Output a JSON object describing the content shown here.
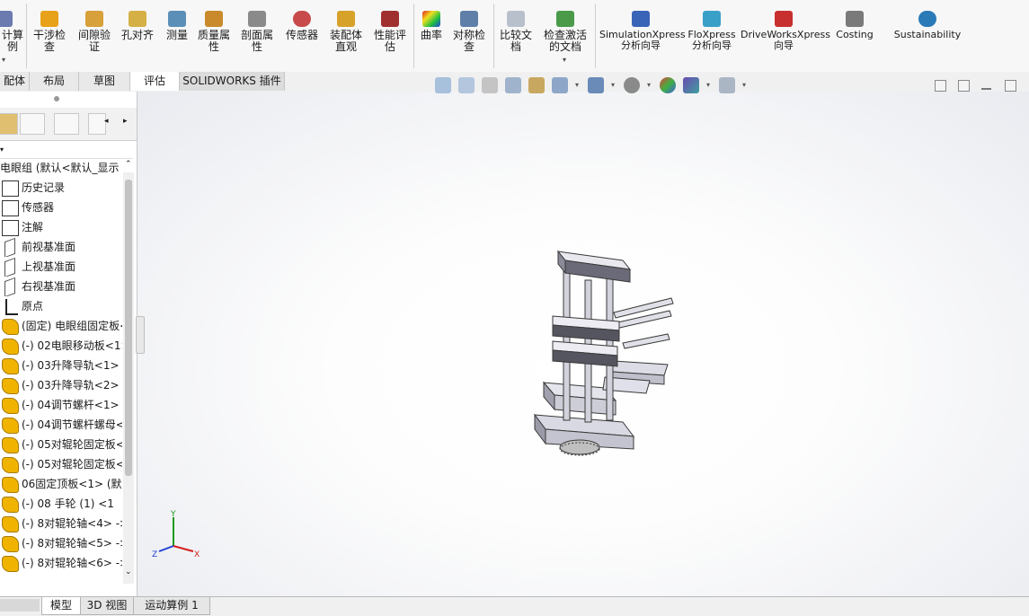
{
  "ribbon": {
    "partial_left_label": "计算例",
    "buttons": [
      {
        "label": "干涉检查",
        "icon": "interference-check-icon"
      },
      {
        "label": "间隙验证",
        "icon": "clearance-verification-icon"
      },
      {
        "label": "孔对齐",
        "icon": "hole-alignment-icon"
      },
      {
        "label": "测量",
        "icon": "measure-icon"
      },
      {
        "label": "质量属性",
        "icon": "mass-properties-icon"
      },
      {
        "label": "剖面属性",
        "icon": "section-properties-icon"
      },
      {
        "label": "传感器",
        "icon": "sensor-icon"
      },
      {
        "label": "装配体直观",
        "icon": "assembly-visualization-icon"
      },
      {
        "label": "性能评估",
        "icon": "performance-evaluation-icon"
      },
      {
        "label": "曲率",
        "icon": "curvature-icon"
      },
      {
        "label": "对称检查",
        "icon": "symmetry-check-icon"
      },
      {
        "label": "比较文档",
        "icon": "compare-documents-icon"
      },
      {
        "label": "检查激活的文档",
        "icon": "check-active-document-icon"
      },
      {
        "label": "SimulationXpress 分析向导",
        "icon": "simulationxpress-icon"
      },
      {
        "label": "FloXpress 分析向导",
        "icon": "floxpress-icon"
      },
      {
        "label": "DriveWorksXpress 向导",
        "icon": "driveworksxpress-icon"
      },
      {
        "label": "Costing",
        "icon": "costing-icon"
      },
      {
        "label": "Sustainability",
        "icon": "sustainability-icon"
      }
    ]
  },
  "tabs": [
    {
      "label": "配体"
    },
    {
      "label": "布局"
    },
    {
      "label": "草图"
    },
    {
      "label": "评估"
    },
    {
      "label": "SOLIDWORKS 插件"
    }
  ],
  "tree": {
    "root": "电眼组 (默认<默认_显示",
    "items": [
      {
        "label": "历史记录",
        "icon": "history-folder-icon"
      },
      {
        "label": "传感器",
        "icon": "sensor-folder-icon"
      },
      {
        "label": "注解",
        "icon": "annotation-folder-icon"
      },
      {
        "label": "前视基准面",
        "icon": "plane-icon"
      },
      {
        "label": "上视基准面",
        "icon": "plane-icon"
      },
      {
        "label": "右视基准面",
        "icon": "plane-icon"
      },
      {
        "label": "原点",
        "icon": "origin-icon"
      },
      {
        "label": "(固定) 电眼组固定板<",
        "icon": "part-icon"
      },
      {
        "label": "(-) 02电眼移动板<1>",
        "icon": "part-icon"
      },
      {
        "label": "(-) 03升降导轨<1> (",
        "icon": "part-icon"
      },
      {
        "label": "(-) 03升降导轨<2> (",
        "icon": "part-icon"
      },
      {
        "label": "(-) 04调节螺杆<1> (",
        "icon": "part-icon"
      },
      {
        "label": "(-) 04调节螺杆螺母<",
        "icon": "part-icon"
      },
      {
        "label": "(-) 05对辊轮固定板<",
        "icon": "part-icon"
      },
      {
        "label": "(-) 05对辊轮固定板<",
        "icon": "part-icon"
      },
      {
        "label": "06固定顶板<1> (默认",
        "icon": "part-icon"
      },
      {
        "label": "(-) 08   手轮 (1) <1",
        "icon": "part-icon"
      },
      {
        "label": "(-) 8对辊轮轴<4> ->",
        "icon": "part-icon"
      },
      {
        "label": "(-) 8对辊轮轴<5> ->",
        "icon": "part-icon"
      },
      {
        "label": "(-) 8对辊轮轴<6> ->",
        "icon": "part-icon"
      }
    ]
  },
  "bottom_tabs": [
    {
      "label": "模型"
    },
    {
      "label": "3D 视图"
    },
    {
      "label": "运动算例 1"
    }
  ],
  "triad": {
    "x": "X",
    "y": "Y",
    "z": "Z"
  },
  "colors": {
    "part": "#f0b400",
    "ribbon_bg": "#f7f7f7",
    "tab_bg": "#e9e9e9",
    "triad_x": "#d42020",
    "triad_y": "#1e9a1e",
    "triad_z": "#1f3fd4"
  }
}
